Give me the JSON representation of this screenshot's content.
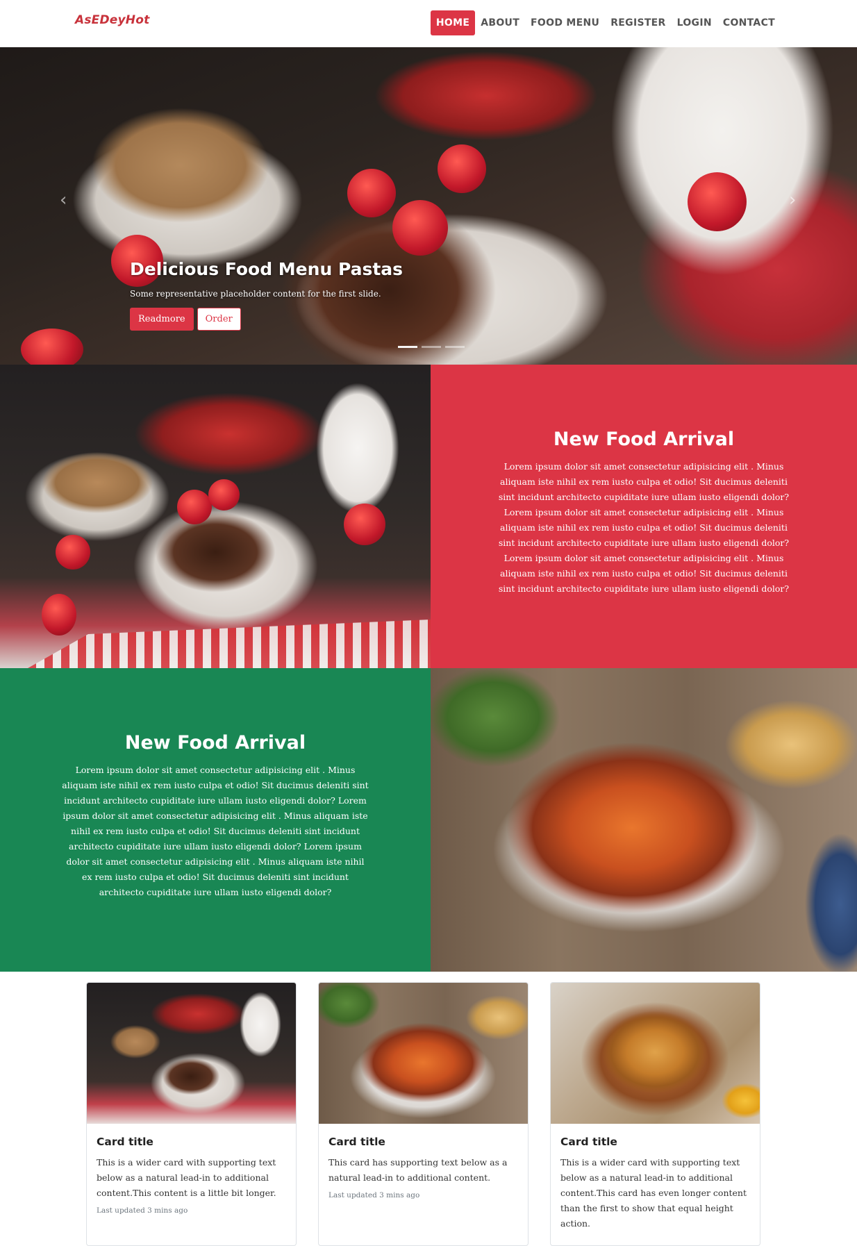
{
  "navbar": {
    "brand": "AsEDeyHot",
    "items": [
      {
        "label": "HOME",
        "active": true
      },
      {
        "label": "ABOUT",
        "active": false
      },
      {
        "label": "FOOD MENU",
        "active": false
      },
      {
        "label": "REGISTER",
        "active": false
      },
      {
        "label": "LOGIN",
        "active": false
      },
      {
        "label": "CONTACT",
        "active": false
      }
    ]
  },
  "hero": {
    "title": "Delicious Food Menu Pastas",
    "subtitle": "Some representative placeholder content for the first slide.",
    "buttons": {
      "readmore": "Readmore",
      "order": "Order"
    },
    "prev_icon": "chevron-left",
    "next_icon": "chevron-right",
    "active_slide": 1,
    "slide_count": 3
  },
  "feature1": {
    "title": "New Food Arrival",
    "text": "Lorem ipsum dolor sit amet consectetur adipisicing elit . Minus aliquam iste nihil ex rem iusto culpa et odio! Sit ducimus deleniti sint incidunt architecto cupiditate iure ullam iusto eligendi dolor? Lorem ipsum dolor sit amet consectetur adipisicing elit . Minus aliquam iste nihil ex rem iusto culpa et odio! Sit ducimus deleniti sint incidunt architecto cupiditate iure ullam iusto eligendi dolor? Lorem ipsum dolor sit amet consectetur adipisicing elit . Minus aliquam iste nihil ex rem iusto culpa et odio! Sit ducimus deleniti sint incidunt architecto cupiditate iure ullam iusto eligendi dolor?",
    "panel_color": "#dc3545"
  },
  "feature2": {
    "title": "New Food Arrival",
    "text": "Lorem ipsum dolor sit amet consectetur adipisicing elit . Minus aliquam iste nihil ex rem iusto culpa et odio! Sit ducimus deleniti sint incidunt architecto cupiditate iure ullam iusto eligendi dolor? Lorem ipsum dolor sit amet consectetur adipisicing elit . Minus aliquam iste nihil ex rem iusto culpa et odio! Sit ducimus deleniti sint incidunt architecto cupiditate iure ullam iusto eligendi dolor? Lorem ipsum dolor sit amet consectetur adipisicing elit . Minus aliquam iste nihil ex rem iusto culpa et odio! Sit ducimus deleniti sint incidunt architecto cupiditate iure ullam iusto eligendi dolor?",
    "panel_color": "#198754"
  },
  "cards": [
    {
      "title": "Card title",
      "text": "This is a wider card with supporting text below as a natural lead-in to additional content.This content is a little bit longer.",
      "updated": "Last updated 3 mins ago"
    },
    {
      "title": "Card title",
      "text": "This card has supporting text below as a natural lead-in to additional content.",
      "updated": "Last updated 3 mins ago"
    },
    {
      "title": "Card title",
      "text": "This is a wider card with supporting text below as a natural lead-in to additional content.This card has even longer content than the first to show that equal height action.",
      "updated": ""
    }
  ],
  "colors": {
    "accent": "#dc3545",
    "green": "#198754",
    "brand": "#c8323b"
  }
}
